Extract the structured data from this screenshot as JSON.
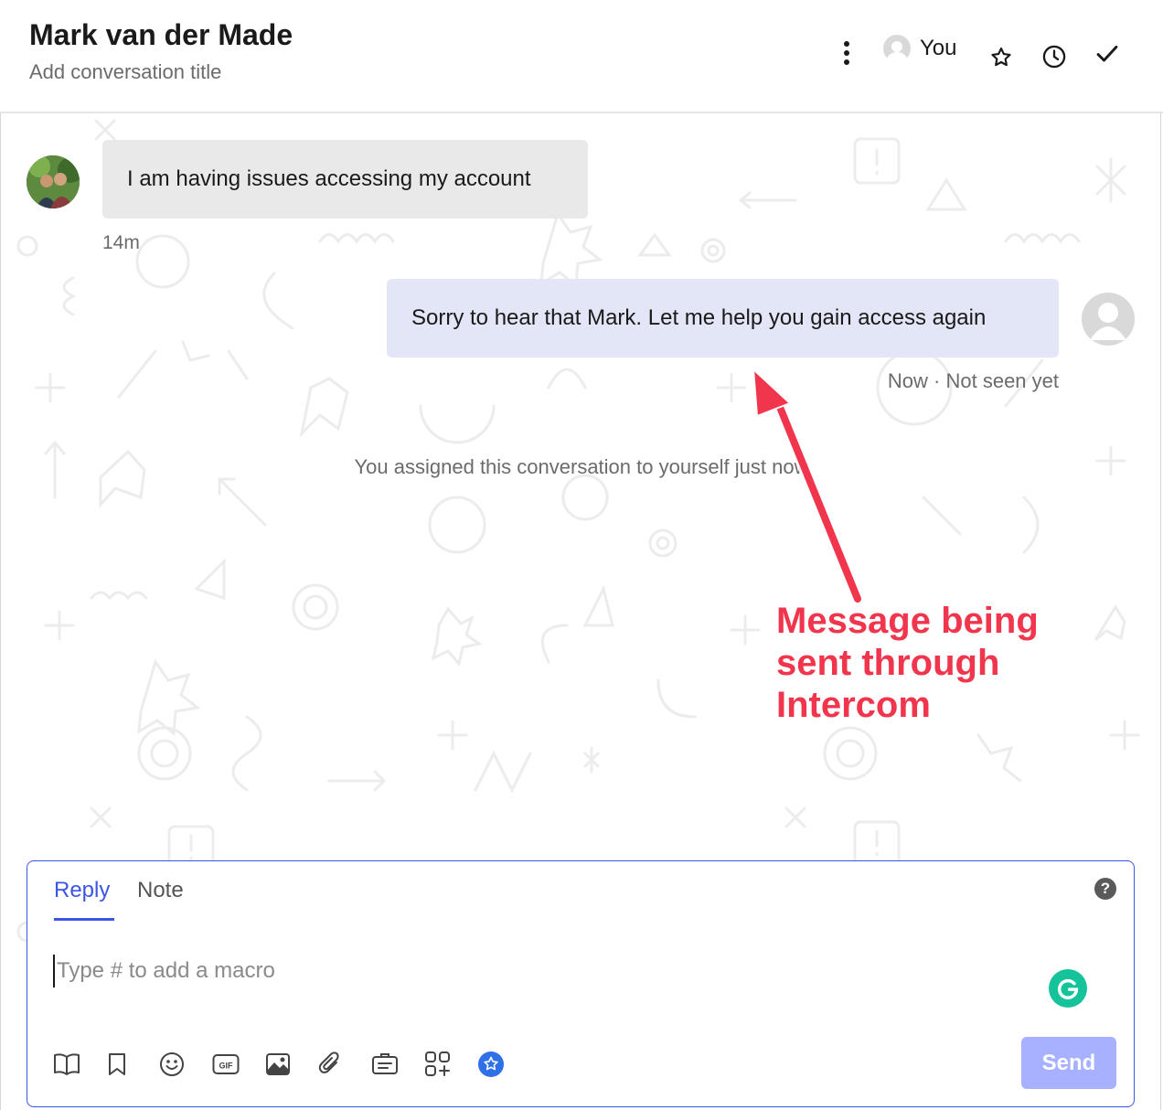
{
  "header": {
    "contact_name": "Mark van der Made",
    "title_placeholder": "Add conversation title",
    "assignee": "You"
  },
  "messages": [
    {
      "direction": "incoming",
      "text": "I am having issues accessing my account",
      "meta": "14m"
    },
    {
      "direction": "outgoing",
      "text": "Sorry to hear that Mark. Let me help you gain access again",
      "meta": "Now · Not seen yet"
    }
  ],
  "system_note": "You assigned this conversation to yourself just now",
  "annotation": {
    "lines": [
      "Message being",
      "sent through",
      "Intercom"
    ],
    "color": "#f0354c"
  },
  "composer": {
    "tabs": [
      {
        "label": "Reply",
        "active": true
      },
      {
        "label": "Note",
        "active": false
      }
    ],
    "placeholder": "Type # to add a macro",
    "send_label": "Send",
    "toolbar_icons": [
      "book-icon",
      "bookmark-icon",
      "emoji-icon",
      "gif-icon",
      "image-icon",
      "attachment-icon",
      "article-icon",
      "apps-icon",
      "ai-star-icon"
    ]
  },
  "colors": {
    "accent": "#3b55e6",
    "outgoing_bubble": "#e2e6f6",
    "incoming_bubble": "#e9e9e9",
    "send_button": "#a7b1ff"
  }
}
